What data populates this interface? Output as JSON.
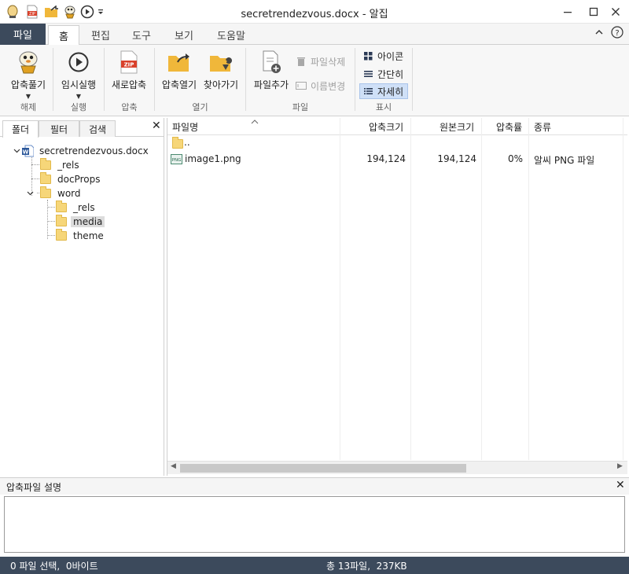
{
  "window": {
    "title": "secretrendezvous.docx - 알집",
    "minimize_icon": "minimize-icon",
    "maximize_icon": "maximize-icon",
    "close_icon": "close-icon"
  },
  "quick_access": [
    {
      "name": "alzip-logo-icon"
    },
    {
      "name": "zip-icon"
    },
    {
      "name": "folder-open-icon"
    },
    {
      "name": "extract-mascot-icon"
    },
    {
      "name": "play-icon"
    },
    {
      "name": "customize-caret-icon"
    }
  ],
  "ribbon_tabs": {
    "file": "파일",
    "items": [
      "홈",
      "편집",
      "도구",
      "보기",
      "도움말"
    ],
    "active": "홈"
  },
  "ribbon": {
    "groups": {
      "extract": "해제",
      "run": "실행",
      "compress": "압축",
      "open": "열기",
      "file": "파일",
      "view": "표시"
    },
    "buttons": {
      "extract": "압축풀기",
      "temp_run": "임시실행",
      "new_compress": "새로압축",
      "open_archive": "압축열기",
      "find": "찾아가기",
      "add_file": "파일추가",
      "delete_file": "파일삭제",
      "rename": "이름변경",
      "icons": "아이콘",
      "simple": "간단히",
      "detail": "자세히"
    },
    "colors": {
      "accent_red": "#d9412b",
      "accent_orange": "#f0a020",
      "selected": "#cfe0f7"
    }
  },
  "left_panel": {
    "tabs": [
      "폴더",
      "필터",
      "검색"
    ],
    "active_tab": "폴더",
    "tree": {
      "root": "secretrendezvous.docx",
      "rels": "_rels",
      "docprops": "docProps",
      "word": "word",
      "word_rels": "_rels",
      "media": "media",
      "theme": "theme"
    }
  },
  "file_list": {
    "columns": {
      "name": "파일명",
      "packed": "압축크기",
      "size": "원본크기",
      "ratio": "압축률",
      "type": "종류"
    },
    "parent_row": "..",
    "rows": [
      {
        "name": "image1.png",
        "packed": "194,124",
        "size": "194,124",
        "ratio": "0%",
        "type": "알씨 PNG 파일",
        "icon": "png-icon"
      }
    ]
  },
  "description": {
    "title": "압축파일 설명",
    "text": ""
  },
  "status": {
    "left": "0 파일 선택,  0바이트",
    "center": "총 13파일,  237KB"
  }
}
